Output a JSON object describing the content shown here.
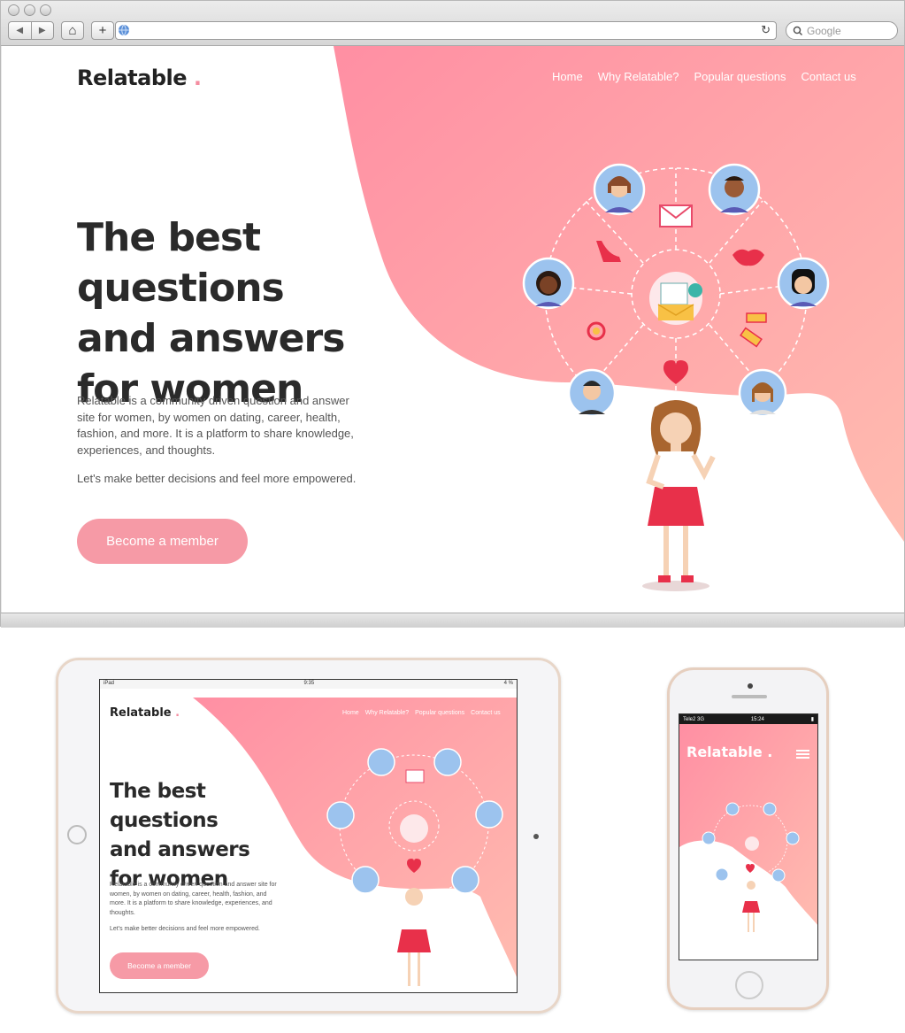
{
  "browser": {
    "search_placeholder": "Google",
    "back_glyph": "◀",
    "forward_glyph": "▶",
    "home_glyph": "⌂",
    "add_glyph": "+",
    "reload_glyph": "↻"
  },
  "site": {
    "logo": "Relatable",
    "logo_dot": ".",
    "nav": [
      "Home",
      "Why Relatable?",
      "Popular questions",
      "Contact us"
    ],
    "heading": [
      "The best questions",
      "and answers",
      "for women"
    ],
    "description": "Relatable is a community driven question and answer site for women, by women on dating, career, health, fashion, and more. It is a platform to share knowledge, experiences, and thoughts.",
    "tagline": "Let's make better decisions and feel more empowered.",
    "cta": "Become a member"
  },
  "ipad": {
    "status_left": "iPad",
    "status_time": "9:35",
    "status_right": "4 %"
  },
  "iphone": {
    "status_carrier": "Tele2  3G",
    "status_time": "15:24",
    "status_right": "▮"
  },
  "colors": {
    "accent": "#f69aa6",
    "pink_gradient_start": "#ff8fa3",
    "pink_gradient_end": "#ffb7ae",
    "text_dark": "#2a2a2a"
  }
}
